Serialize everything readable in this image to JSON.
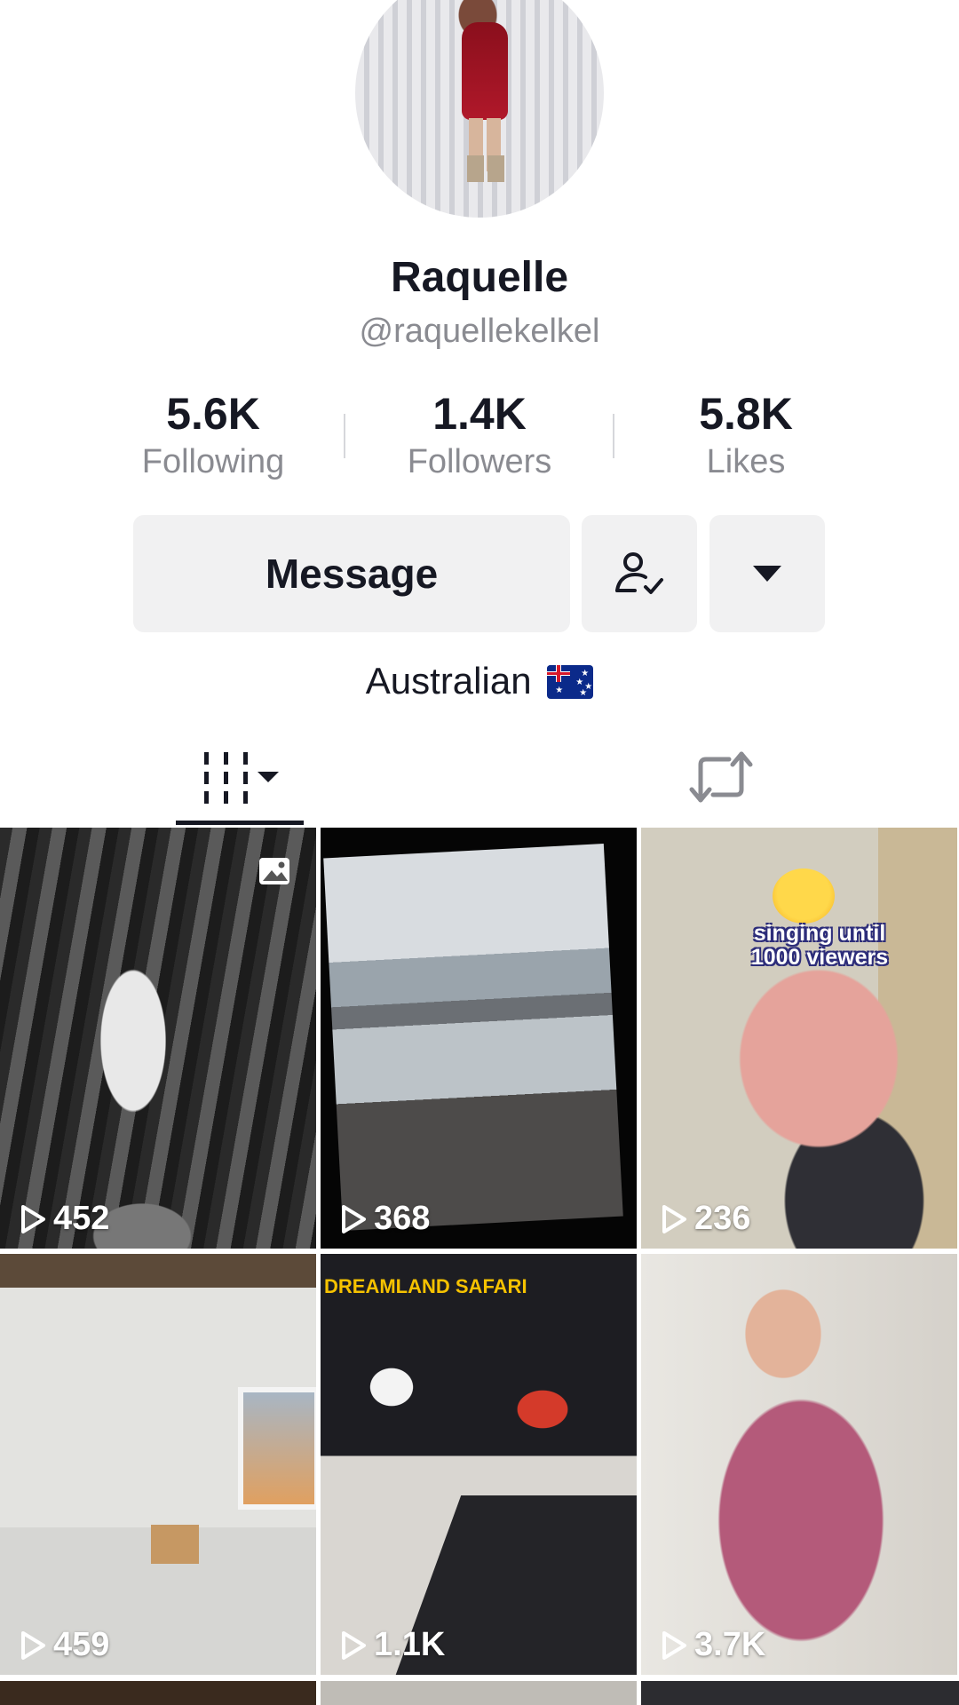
{
  "profile": {
    "display_name": "Raquelle",
    "handle": "@raquellekelkel",
    "bio": "Australian",
    "bio_flag": "australia-flag-icon"
  },
  "stats": {
    "following": {
      "value": "5.6K",
      "label": "Following"
    },
    "followers": {
      "value": "1.4K",
      "label": "Followers"
    },
    "likes": {
      "value": "5.8K",
      "label": "Likes"
    }
  },
  "actions": {
    "message_label": "Message",
    "following_icon": "user-check-icon",
    "more_icon": "caret-down-icon"
  },
  "tabs": [
    {
      "name": "videos-grid-tab",
      "icon": "grid-columns-icon",
      "active": true
    },
    {
      "name": "reposts-tab",
      "icon": "repost-icon",
      "active": false
    }
  ],
  "videos": [
    {
      "views": "452",
      "type": "photo"
    },
    {
      "views": "368"
    },
    {
      "views": "236",
      "caption": "singing until 1000 viewers"
    },
    {
      "views": "459"
    },
    {
      "views": "1.1K",
      "sign": "DREAMLAND SAFARI"
    },
    {
      "views": "3.7K"
    }
  ],
  "colors": {
    "text": "#161823",
    "secondary": "#8a8b91",
    "button_bg": "#f1f1f2"
  }
}
